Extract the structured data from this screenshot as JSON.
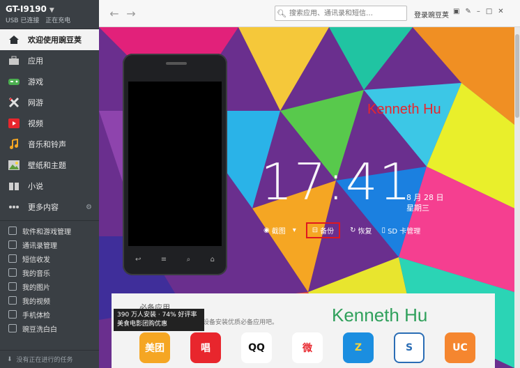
{
  "device": {
    "name": "GT-I9190",
    "usb_status": "USB 已连接",
    "charge_status": "正在充电"
  },
  "nav": [
    {
      "label": "欢迎使用豌豆荚",
      "icon": "home-icon",
      "active": true
    },
    {
      "label": "应用",
      "icon": "briefcase-icon"
    },
    {
      "label": "游戏",
      "icon": "gamepad-icon"
    },
    {
      "label": "网游",
      "icon": "swords-icon"
    },
    {
      "label": "视频",
      "icon": "play-icon"
    },
    {
      "label": "音乐和铃声",
      "icon": "music-note-icon"
    },
    {
      "label": "壁纸和主题",
      "icon": "picture-icon"
    },
    {
      "label": "小说",
      "icon": "book-icon"
    },
    {
      "label": "更多内容",
      "icon": "more-dots-icon"
    }
  ],
  "tools": [
    {
      "label": "软件和游戏管理"
    },
    {
      "label": "通讯录管理"
    },
    {
      "label": "短信收发"
    },
    {
      "label": "我的音乐"
    },
    {
      "label": "我的图片"
    },
    {
      "label": "我的视频"
    },
    {
      "label": "手机体检"
    },
    {
      "label": "豌豆洗白白"
    }
  ],
  "tasks_label": "没有正在进行的任务",
  "search": {
    "placeholder": "搜索应用、通讯录和短信…"
  },
  "login_label": "登录豌豆荚",
  "wallpaper": {
    "name_red": "Kenneth Hu",
    "time": "17:41",
    "date": "8 月 28 日",
    "weekday": "星期三"
  },
  "actions": [
    {
      "label": "截图",
      "icon": "camera-icon"
    },
    {
      "label": "备份",
      "icon": "backup-icon",
      "highlight": true
    },
    {
      "label": "恢复",
      "icon": "restore-icon"
    },
    {
      "label": "SD 卡管理",
      "icon": "sd-card-icon"
    }
  ],
  "panel": {
    "title": "必备应用",
    "subtitle": "的设备安装优质必备应用吧。",
    "name_green": "Kenneth Hu",
    "tooltip_line1": "390 万人安装 · 74% 好评率",
    "tooltip_line2": "美食电影团购优惠"
  },
  "apps": [
    {
      "name": "meituan-icon",
      "text": "美团",
      "color": "#f5a623"
    },
    {
      "name": "changba-icon",
      "text": "唱",
      "color": "#e8262d"
    },
    {
      "name": "qq-icon",
      "text": "QQ",
      "color": "#ffffff"
    },
    {
      "name": "weibo-icon",
      "text": "微",
      "color": "#ffffff"
    },
    {
      "name": "zhangyue-icon",
      "text": "Z",
      "color": "#1b8ee0"
    },
    {
      "name": "security-icon",
      "text": "S",
      "color": "#ffffff"
    },
    {
      "name": "uc-browser-icon",
      "text": "UC",
      "color": "#f5862f"
    }
  ]
}
